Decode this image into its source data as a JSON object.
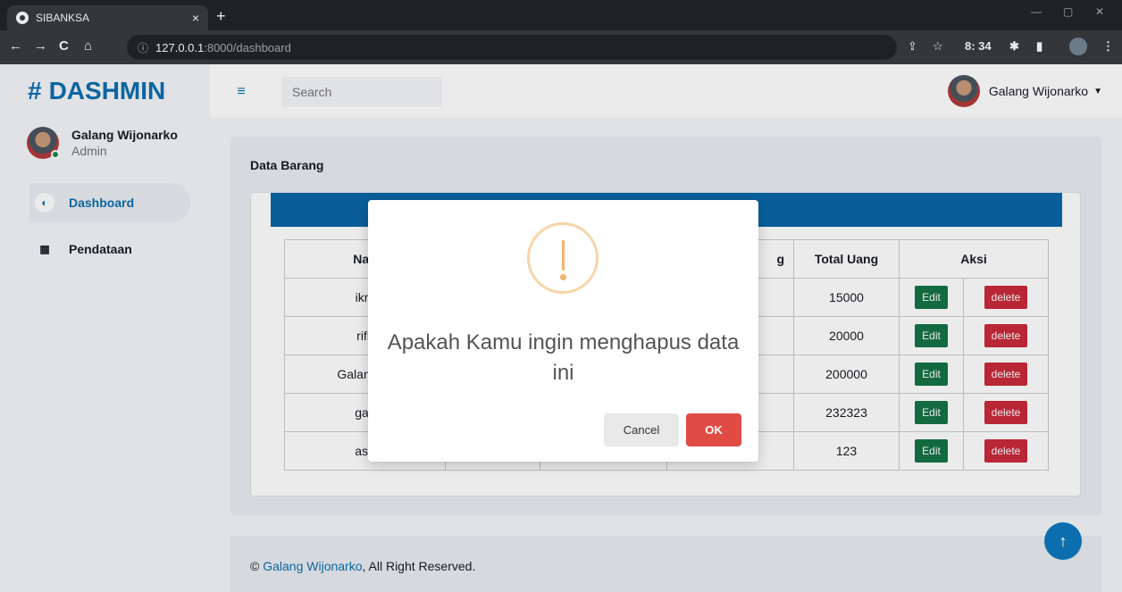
{
  "browser": {
    "tab_title": "SIBANKSA",
    "tab_close": "×",
    "new_tab": "+",
    "url_host": "127.0.0.1",
    "url_path": ":8000/dashboard",
    "ext_text": "8: 34",
    "window_controls": {
      "minimize": "—",
      "restore": "▢",
      "close": "✕"
    },
    "nav": {
      "back": "←",
      "forward": "→",
      "reload": "C",
      "home": "⌂"
    }
  },
  "sidebar": {
    "brand_hash": "#",
    "brand": "DASHMIN",
    "user_name": "Galang Wijonarko",
    "user_role": "Admin",
    "items": [
      {
        "label": "Dashboard",
        "icon": "gauge-icon",
        "active": true
      },
      {
        "label": "Pendataan",
        "icon": "grid-icon",
        "active": false
      }
    ]
  },
  "topbar": {
    "search_placeholder": "Search",
    "user_name": "Galang Wijonarko"
  },
  "main": {
    "card_title": "Data Barang",
    "table": {
      "headers": [
        "Nan",
        "",
        "",
        "g",
        "Total Uang",
        "Aksi"
      ],
      "rows": [
        {
          "name": "ikm",
          "total": "15000"
        },
        {
          "name": "rifk",
          "total": "20000"
        },
        {
          "name": "Galang W",
          "total": "200000"
        },
        {
          "name": "galı",
          "total": "232323"
        },
        {
          "name": "asd",
          "total": "123"
        }
      ],
      "edit_label": "Edit",
      "delete_label": "delete"
    }
  },
  "footer": {
    "copyright": "©",
    "author_link": "Galang Wijonarko",
    "rest": ", All Right Reserved."
  },
  "modal": {
    "message": "Apakah Kamu ingin menghapus data ini",
    "cancel_label": "Cancel",
    "ok_label": "OK"
  },
  "colors": {
    "accent": "#0d6eaf",
    "edit_btn": "#157347",
    "delete_btn": "#c92a3a",
    "ok_btn": "#e14b45",
    "warning": "#f2b46e"
  }
}
